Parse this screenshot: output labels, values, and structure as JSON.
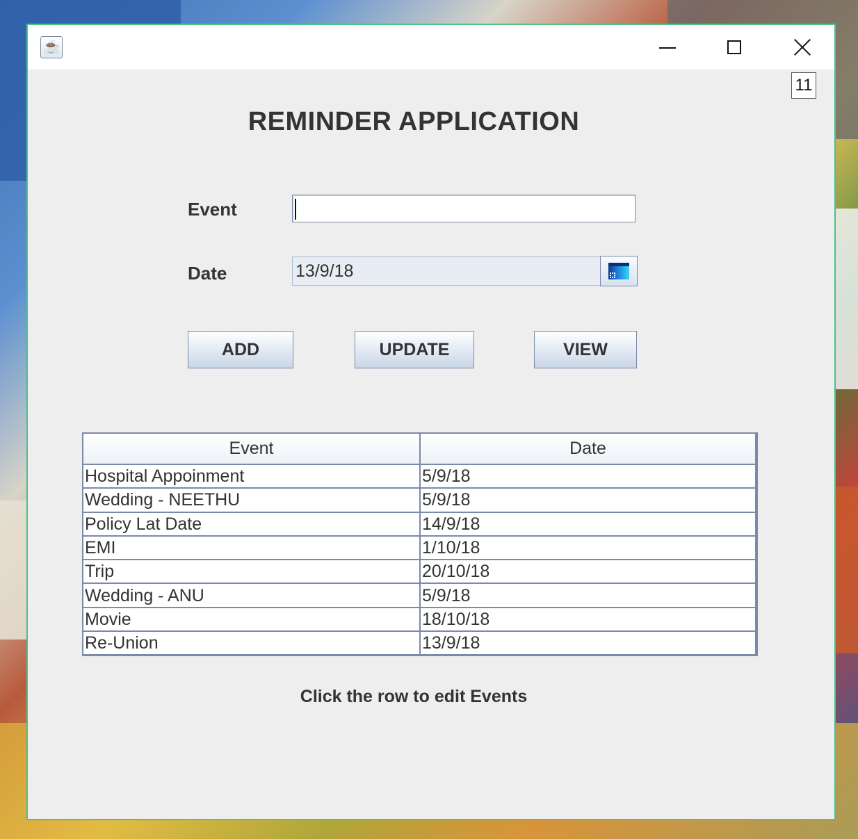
{
  "window": {
    "icon": "java-app-icon",
    "controls": {
      "minimize": "minimize-icon",
      "maximize": "maximize-icon",
      "close": "close-icon"
    }
  },
  "counter": "11",
  "title": "REMINDER APPLICATION",
  "form": {
    "event_label": "Event",
    "event_value": "",
    "date_label": "Date",
    "date_value": "13/9/18",
    "calendar_icon": "calendar-icon"
  },
  "buttons": {
    "add": "ADD",
    "update": "UPDATE",
    "view": "VIEW"
  },
  "table": {
    "columns": [
      "Event",
      "Date"
    ],
    "rows": [
      [
        "Hospital Appoinment",
        "5/9/18"
      ],
      [
        "Wedding - NEETHU",
        "5/9/18"
      ],
      [
        "Policy Lat Date",
        "14/9/18"
      ],
      [
        "EMI",
        "1/10/18"
      ],
      [
        "Trip",
        "20/10/18"
      ],
      [
        "Wedding - ANU",
        "5/9/18"
      ],
      [
        "Movie",
        "18/10/18"
      ],
      [
        "Re-Union",
        "13/9/18"
      ]
    ]
  },
  "hint": "Click the row to edit Events",
  "colors": {
    "window_bg": "#eeeeee",
    "window_border": "#4ac28a",
    "text": "#333333",
    "grid": "#7a8aa8"
  }
}
